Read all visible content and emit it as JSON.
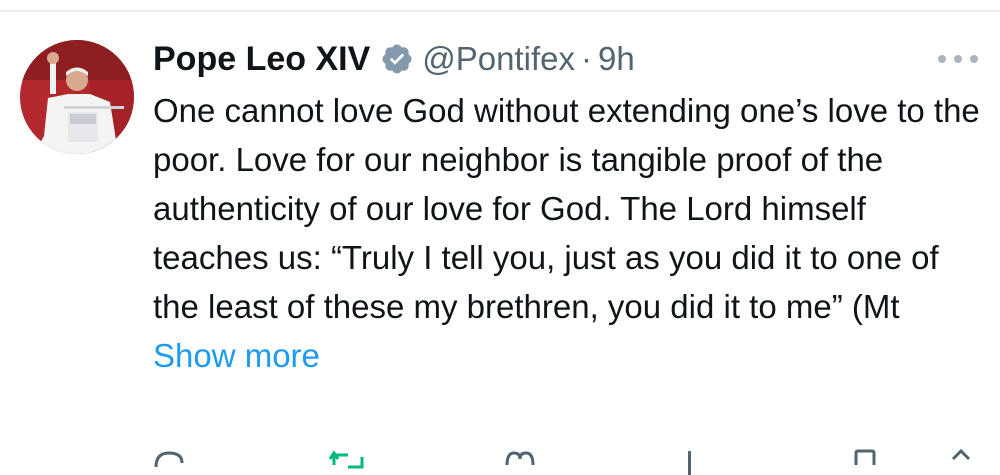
{
  "tweet": {
    "display_name": "Pope Leo XIV",
    "handle": "@Pontifex",
    "separator": "·",
    "time": "9h",
    "text": "One cannot love God without extending one’s love to the poor. Love for our neighbor is tangible proof of the authenticity of our love for God. The Lord himself teaches us: “Truly I tell you, just as you did it to one of the least of these my brethren, you did it to me” (Mt ",
    "show_more": "Show more"
  },
  "icons": {
    "verified": "verified-badge-icon",
    "more": "more-options-icon",
    "actions": [
      "reply-icon",
      "repost-icon",
      "like-icon",
      "views-icon",
      "bookmark-icon",
      "share-icon"
    ]
  },
  "colors": {
    "text": "#0f1419",
    "secondary": "#536471",
    "link": "#1d9bf0",
    "repost_active": "#00ba7c",
    "verified_badge": "#829aab"
  }
}
